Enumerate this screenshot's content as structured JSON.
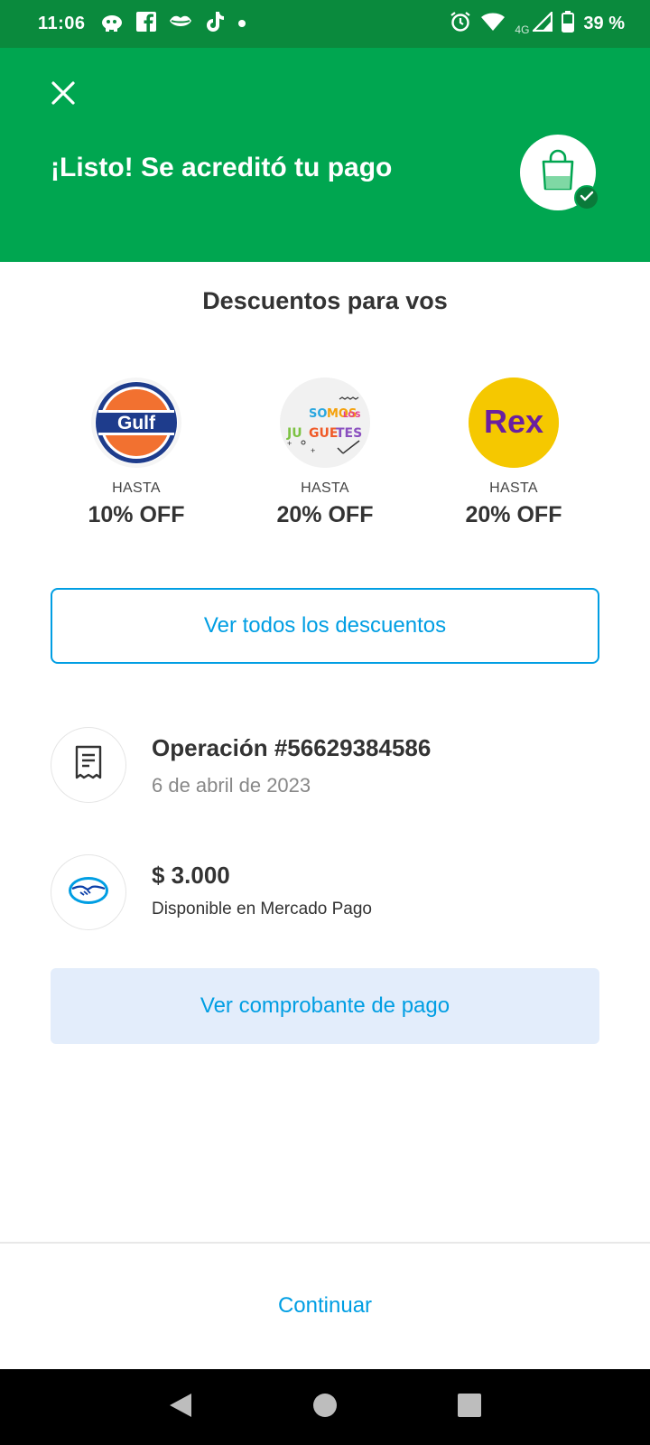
{
  "status_bar": {
    "time": "11:06",
    "network": "4G",
    "battery": "39 %",
    "left_icons": [
      "cloud-mascot-icon",
      "facebook-icon",
      "lips-icon",
      "tiktok-icon",
      "dot-icon"
    ],
    "right_icons": [
      "alarm-icon",
      "wifi-icon",
      "signal-icon",
      "battery-icon"
    ]
  },
  "header": {
    "title": "¡Listo! Se acreditó tu pago",
    "background": "#00a650",
    "badge_icon": "shopping-bag-icon",
    "check_icon": "check-icon"
  },
  "discounts": {
    "title": "Descuentos para vos",
    "items": [
      {
        "brand": "Gulf",
        "hasta": "HASTA",
        "value": "10% OFF"
      },
      {
        "brand": "SOMOS LOS JUGUETES",
        "hasta": "HASTA",
        "value": "20% OFF"
      },
      {
        "brand": "Rex",
        "hasta": "HASTA",
        "value": "20% OFF"
      }
    ],
    "see_all_label": "Ver todos los descuentos"
  },
  "operation": {
    "title": "Operación #56629384586",
    "date": "6 de abril de 2023",
    "icon": "receipt-icon"
  },
  "amount": {
    "value": "$ 3.000",
    "description": "Disponible en Mercado Pago",
    "icon": "mercado-pago-handshake-icon"
  },
  "receipt_button": "Ver comprobante de pago",
  "continue_button": "Continuar",
  "colors": {
    "accent": "#009ee3",
    "success": "#00a650",
    "status_bar": "#0a8a3d"
  }
}
